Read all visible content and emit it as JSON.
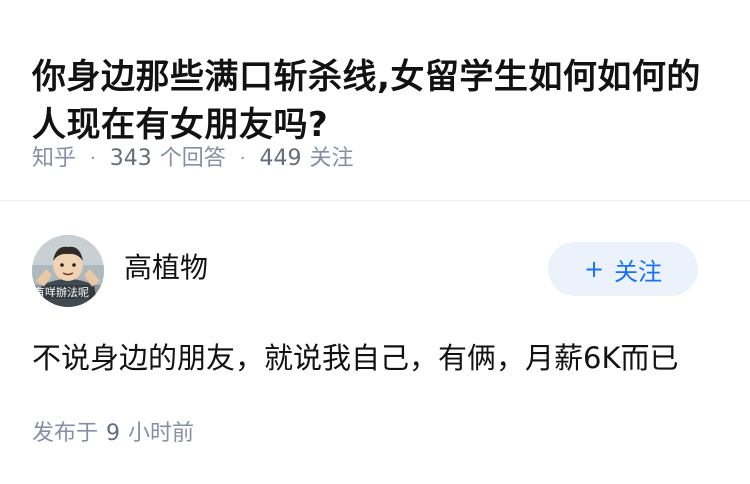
{
  "question": {
    "title": "你身边那些满口斩杀线,女留学生如何如何的人现在有女朋友吗?",
    "source": "知乎",
    "answer_count": "343",
    "answer_label": "个回答",
    "follower_count": "449",
    "follower_label": "关注"
  },
  "answer": {
    "avatar_caption": "有咩辦法呢",
    "author_name": "高植物",
    "follow_plus": "+",
    "follow_label": "关注",
    "content": "不说身边的朋友，就说我自己，有俩，月薪6K而已",
    "time_prefix": "发布于",
    "time_number": "9",
    "time_suffix": "小时前"
  },
  "colors": {
    "text_primary": "#121212",
    "text_meta": "#8590a6",
    "follow_bg": "#ebf2fb",
    "follow_text": "#1772f6"
  }
}
